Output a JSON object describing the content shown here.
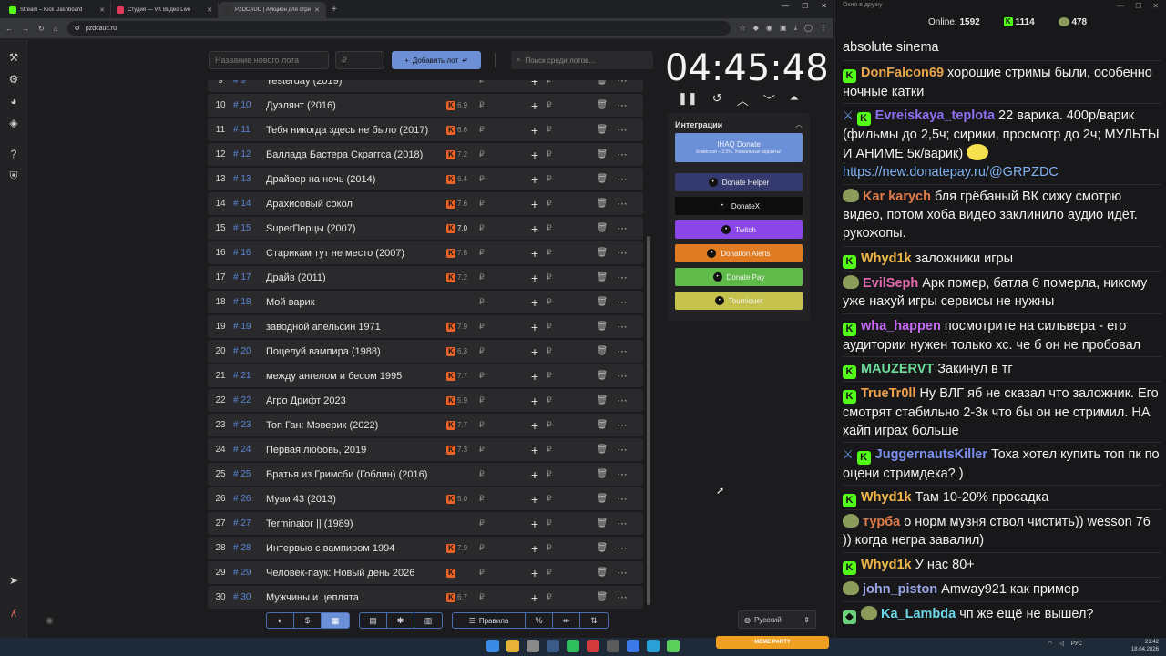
{
  "browser": {
    "tabs": [
      {
        "title": "Stream – Kick Dashboard",
        "color": "#53fc18"
      },
      {
        "title": "Студия — VK Видео Live",
        "color": "#e03a5a"
      },
      {
        "title": "PZDCAUC | Аукцион для стри",
        "color": "#333333"
      }
    ],
    "url": "pzdcauc.ru"
  },
  "toolbar": {
    "lot_placeholder": "Название нового лота",
    "price_placeholder": "₽",
    "add_lot_label": "Добавить лот",
    "search_placeholder": "Поиск среди лотов..."
  },
  "lots": [
    {
      "num": "9",
      "id": "# 9",
      "name": "Yesterday (2019)",
      "rating": "",
      "bright": false
    },
    {
      "num": "10",
      "id": "# 10",
      "name": "Дуэлянт (2016)",
      "rating": "6.9",
      "bright": false
    },
    {
      "num": "11",
      "id": "# 11",
      "name": " Тебя никогда здесь не было (2017)",
      "rating": "6.6",
      "bright": false
    },
    {
      "num": "12",
      "id": "# 12",
      "name": "Баллада Бастера Скраггса (2018)",
      "rating": "7.2",
      "bright": false
    },
    {
      "num": "13",
      "id": "# 13",
      "name": "Драйвер на ночь (2014)",
      "rating": "6.4",
      "bright": false
    },
    {
      "num": "14",
      "id": "# 14",
      "name": "Арахисовый сокол",
      "rating": "7.6",
      "bright": false
    },
    {
      "num": "15",
      "id": "# 15",
      "name": "SuperПерцы (2007)",
      "rating": "7.0",
      "bright": true
    },
    {
      "num": "16",
      "id": "# 16",
      "name": "Старикам тут не место (2007)",
      "rating": "7.8",
      "bright": false
    },
    {
      "num": "17",
      "id": "# 17",
      "name": "Драйв (2011)",
      "rating": "7.2",
      "bright": false
    },
    {
      "num": "18",
      "id": "# 18",
      "name": "Мой варик",
      "rating": "",
      "bright": false
    },
    {
      "num": "19",
      "id": "# 19",
      "name": "заводной апельсин 1971",
      "rating": "7.9",
      "bright": false
    },
    {
      "num": "20",
      "id": "# 20",
      "name": "Поцелуй вампира (1988)",
      "rating": "6.3",
      "bright": false
    },
    {
      "num": "21",
      "id": "# 21",
      "name": "между ангелом и бесом 1995",
      "rating": "7.7",
      "bright": false
    },
    {
      "num": "22",
      "id": "# 22",
      "name": "Агро Дрифт 2023",
      "rating": "5.9",
      "bright": false
    },
    {
      "num": "23",
      "id": "# 23",
      "name": " Топ Ган: Мэверик (2022)",
      "rating": "7.7",
      "bright": false
    },
    {
      "num": "24",
      "id": "# 24",
      "name": "Первая любовь, 2019",
      "rating": "7.3",
      "bright": false
    },
    {
      "num": "25",
      "id": "# 25",
      "name": "Братья из Гримсби (Гоблин) (2016)",
      "rating": "",
      "bright": false
    },
    {
      "num": "26",
      "id": "# 26",
      "name": "Муви 43 (2013)",
      "rating": "5.0",
      "bright": false
    },
    {
      "num": "27",
      "id": "# 27",
      "name": "Terminator || (1989)",
      "rating": "",
      "bright": false
    },
    {
      "num": "28",
      "id": "# 28",
      "name": "Интервью с вампиром 1994",
      "rating": "7.9",
      "bright": false
    },
    {
      "num": "29",
      "id": "# 29",
      "name": "Человек-паук: Новый день 2026",
      "rating": " ",
      "bright": false
    },
    {
      "num": "30",
      "id": "# 30",
      "name": "Мужчины и цеплята",
      "rating": "6.7",
      "bright": false
    }
  ],
  "currency": "₽",
  "timer": {
    "value": "04:45:48"
  },
  "integrations": {
    "title": "Интеграции",
    "items": [
      {
        "label": "IHAQ Donate",
        "sub": "Комиссия – 3,5%. Уникальные виджеты!",
        "color": "#6b90d8"
      },
      {
        "label": "Donate Helper",
        "color": "#353a6e"
      },
      {
        "label": "DonateX",
        "color": "#0d0d0d"
      },
      {
        "label": "Twitch",
        "color": "#8a46e6"
      },
      {
        "label": "Donation Alerts",
        "color": "#e07b22"
      },
      {
        "label": "Donate Pay",
        "color": "#5fba4a"
      },
      {
        "label": "Tourniquet",
        "color": "#c6c24e"
      }
    ]
  },
  "bottombar": {
    "rules_label": "Правила"
  },
  "language": "Русский",
  "chat": {
    "title": "Окно в дружу",
    "online_label": "Online:",
    "online": "1592",
    "kick_count": "1114",
    "vk_count": "478",
    "messages": [
      {
        "user": "",
        "color": "#f1f1f1",
        "text": "absolute sinema",
        "badges": ""
      },
      {
        "user": "DonFalcon69",
        "color": "#e9a44a",
        "text": "хорошие стримы были, особенно ночные катки",
        "badges": "k"
      },
      {
        "user": "Evreiskaya_teplota",
        "color": "#8e6ff0",
        "text": "22 варика. 400р/варик (фильмы до 2,5ч; сирики, просмотр до 2ч; МУЛЬТЫ И АНИМЕ 5к/варик)",
        "link": "https://new.donatepay.ru/@GRPZDC",
        "badges": "sk"
      },
      {
        "user": "Kar karych",
        "color": "#e07c4a",
        "text": "бля грёбаный ВК сижу смотрю видео, потом хоба видео заклинило аудио идёт. рукожопы.",
        "badges": "a"
      },
      {
        "user": "Whyd1k",
        "color": "#f0b64a",
        "text": "заложники игры",
        "badges": "k"
      },
      {
        "user": "EvilSeph",
        "color": "#e66ab0",
        "text": "Арк помер, батла 6 померла, никому уже нахуй игры сервисы не нужны",
        "badges": "a"
      },
      {
        "user": "wha_happen",
        "color": "#c26af0",
        "text": "посмотрите на сильвера - его аудитории нужен только хс. че б он не пробовал",
        "badges": "k"
      },
      {
        "user": "MAUZERVT",
        "color": "#6fdc9a",
        "text": "Закинул в тг",
        "badges": "k"
      },
      {
        "user": "TrueTr0ll",
        "color": "#f0a04a",
        "text": "Ну ВЛГ яб не сказал что заложник. Его смотрят стабильно 2-3к что бы он не стримил. НА хайп играх больше",
        "badges": "k"
      },
      {
        "user": "JuggernautsKiller",
        "color": "#7a8ff0",
        "text": "Тоха хотел купить топ пк по оцени стримдека? )",
        "badges": "sk"
      },
      {
        "user": "Whyd1k",
        "color": "#f0b64a",
        "text": "Там 10-20% просадка",
        "badges": "k"
      },
      {
        "user": "турба",
        "color": "#e07c4a",
        "text": "о норм музня ствол чистить)) wesson 76 )) когда негра завалил)",
        "badges": "a"
      },
      {
        "user": "Whyd1k",
        "color": "#f0b64a",
        "text": "У нас 80+",
        "badges": "k"
      },
      {
        "user": "john_piston",
        "color": "#9aa8e8",
        "text": "Amway921 как пример",
        "badges": "a"
      },
      {
        "user": "Ka_Lambda",
        "color": "#6ad8e8",
        "text": "чп же ещё не вышел?",
        "badges": "ga"
      }
    ]
  },
  "meme_widget": {
    "label": "MEME PARTY"
  },
  "taskbar": {
    "lang": "РУС",
    "time": "21:42",
    "date": "18.04.2026"
  }
}
